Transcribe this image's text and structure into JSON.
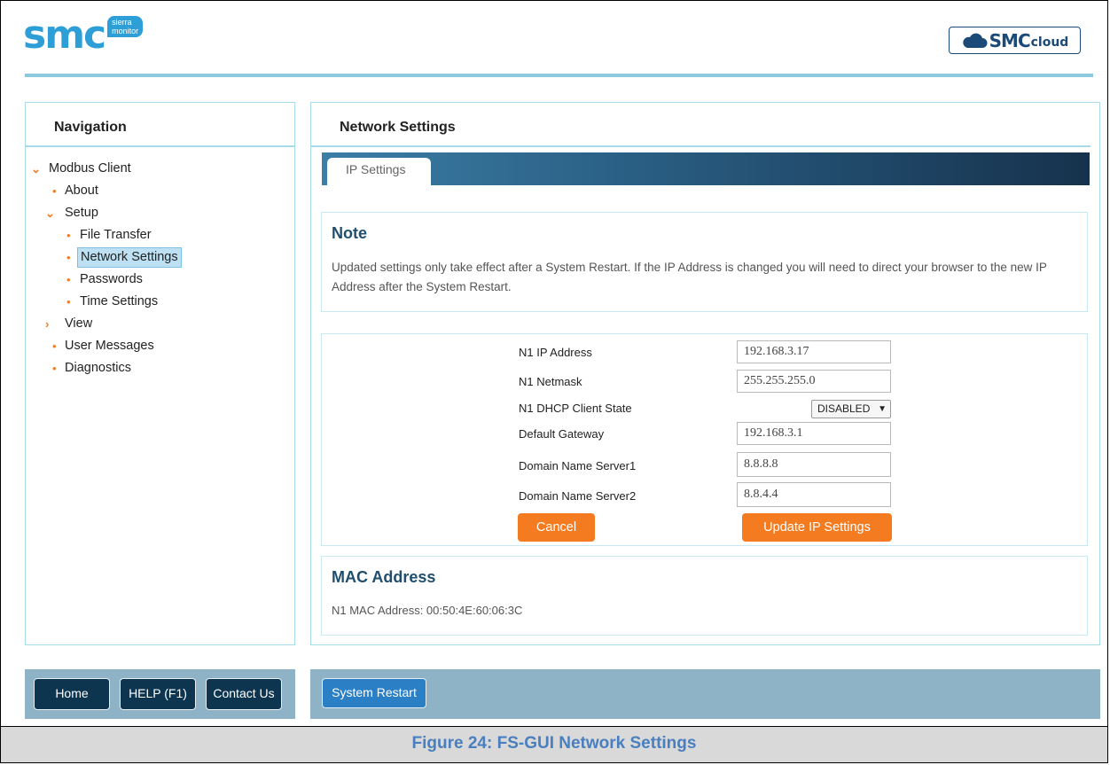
{
  "header": {
    "logo_text": "smc",
    "logo_sub_1": "sierra",
    "logo_sub_2": "monitor",
    "cloud_brand": "SMC",
    "cloud_word": "cloud"
  },
  "nav": {
    "title": "Navigation",
    "items": [
      {
        "label": "Modbus Client",
        "kind": "expanded"
      },
      {
        "label": "About",
        "kind": "leaf"
      },
      {
        "label": "Setup",
        "kind": "expanded"
      },
      {
        "label": "File Transfer",
        "kind": "leaf"
      },
      {
        "label": "Network Settings",
        "kind": "leaf",
        "active": true
      },
      {
        "label": "Passwords",
        "kind": "leaf"
      },
      {
        "label": "Time Settings",
        "kind": "leaf"
      },
      {
        "label": "View",
        "kind": "collapsed"
      },
      {
        "label": "User Messages",
        "kind": "leaf"
      },
      {
        "label": "Diagnostics",
        "kind": "leaf"
      }
    ]
  },
  "main": {
    "title": "Network Settings",
    "tab_label": "IP Settings",
    "note": {
      "title": "Note",
      "text": "Updated settings only take effect after a System Restart. If the IP Address is changed you will need to direct your browser to the new IP Address after the System Restart."
    },
    "form": {
      "ip_label": "N1 IP Address",
      "ip_value": "192.168.3.17",
      "netmask_label": "N1 Netmask",
      "netmask_value": "255.255.255.0",
      "dhcp_label": "N1 DHCP Client State",
      "dhcp_value": "DISABLED",
      "gateway_label": "Default Gateway",
      "gateway_value": "192.168.3.1",
      "dns1_label": "Domain Name Server1",
      "dns1_value": "8.8.8.8",
      "dns2_label": "Domain Name Server2",
      "dns2_value": "8.8.4.4",
      "cancel_label": "Cancel",
      "update_label": "Update IP Settings"
    },
    "mac": {
      "title": "MAC Address",
      "text": "N1 MAC Address: 00:50:4E:60:06:3C"
    }
  },
  "footer": {
    "home_label": "Home",
    "help_label": "HELP (F1)",
    "contact_label": "Contact Us",
    "restart_label": "System Restart"
  },
  "caption": "Figure 24: FS-GUI Network Settings",
  "colors": {
    "accent_orange": "#f47b20",
    "brand_blue": "#2e9fd6",
    "panel_border": "#a7dbea",
    "footer_bar": "#8fb3c6",
    "dark_button": "#0d3550"
  }
}
